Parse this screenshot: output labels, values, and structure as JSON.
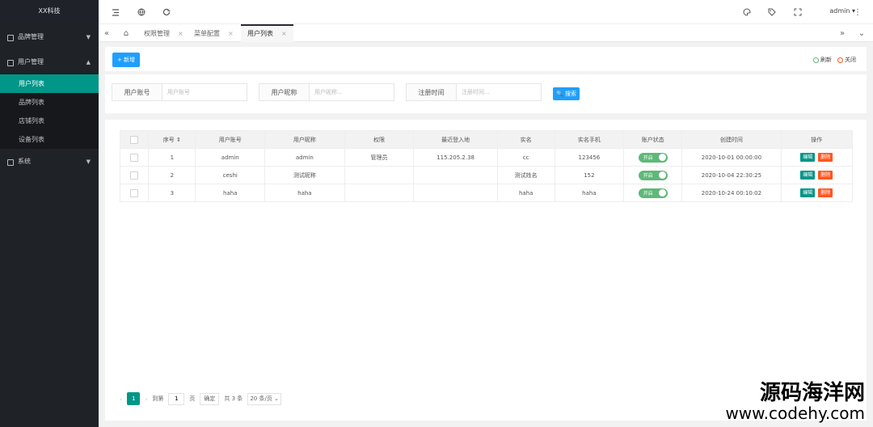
{
  "sidebar": {
    "logo": "XX科技",
    "groups": [
      {
        "label": "品牌管理",
        "arrow": "▼"
      },
      {
        "label": "用户管理",
        "arrow": "▲"
      },
      {
        "label": "系统",
        "arrow": "▼"
      }
    ],
    "sub_items": [
      "用户列表",
      "品牌列表",
      "店铺列表",
      "设备列表"
    ]
  },
  "header": {
    "icons": [
      "menu-icon",
      "globe-icon",
      "refresh-icon",
      "theme-icon",
      "tag-icon",
      "fullscreen-icon",
      "more-icon"
    ],
    "user": "admin ▾",
    "more": "⋮"
  },
  "tabs": {
    "prev": "«",
    "next": "»",
    "dropdown": "⌄",
    "home_icon": "⌂",
    "items": [
      {
        "label": "权限管理",
        "close": "×"
      },
      {
        "label": "菜单配置",
        "close": "×"
      },
      {
        "label": "用户列表",
        "close": "×"
      }
    ]
  },
  "toolbar": {
    "add_label": "+ 新增",
    "refresh_label": "刷新",
    "close_label": "关闭",
    "refresh_color": "#5fb878",
    "close_color": "#ff5722"
  },
  "search": {
    "account_label": "用户账号",
    "account_placeholder": "用户账号",
    "nickname_label": "用户昵称",
    "nickname_placeholder": "用户昵称...",
    "regtime_label": "注册时间",
    "regtime_placeholder": "注册时间...",
    "search_label": "🔍 搜索"
  },
  "table": {
    "headers": [
      "",
      "序号 ⇕",
      "用户账号",
      "用户昵称",
      "权限",
      "最近登入地",
      "实名",
      "实名手机",
      "账户状态",
      "创建时间",
      "操作"
    ],
    "rows": [
      {
        "no": "1",
        "account": "admin",
        "nickname": "admin",
        "role": "管理员",
        "ip": "115.205.2.38",
        "realname": "cc",
        "phone": "123456",
        "status": "开启",
        "created": "2020-10-01 00:00:00"
      },
      {
        "no": "2",
        "account": "ceshi",
        "nickname": "测试昵称",
        "role": "",
        "ip": "",
        "realname": "测试姓名",
        "phone": "152",
        "status": "开启",
        "created": "2020-10-04 22:30:25"
      },
      {
        "no": "3",
        "account": "haha",
        "nickname": "haha",
        "role": "",
        "ip": "",
        "realname": "haha",
        "phone": "haha",
        "status": "开启",
        "created": "2020-10-24 00:10:02"
      }
    ],
    "edit_label": "编辑",
    "delete_label": "删除"
  },
  "pager": {
    "prev": "‹",
    "current": "1",
    "next": "›",
    "goto_label": "到第",
    "goto_value": "1",
    "page_unit": "页",
    "confirm_label": "确定",
    "total": "共 3 条",
    "per_page": "20 条/页 ⌄"
  },
  "watermark": {
    "line1": "源码海洋网",
    "line2": "www.codehy.com"
  }
}
